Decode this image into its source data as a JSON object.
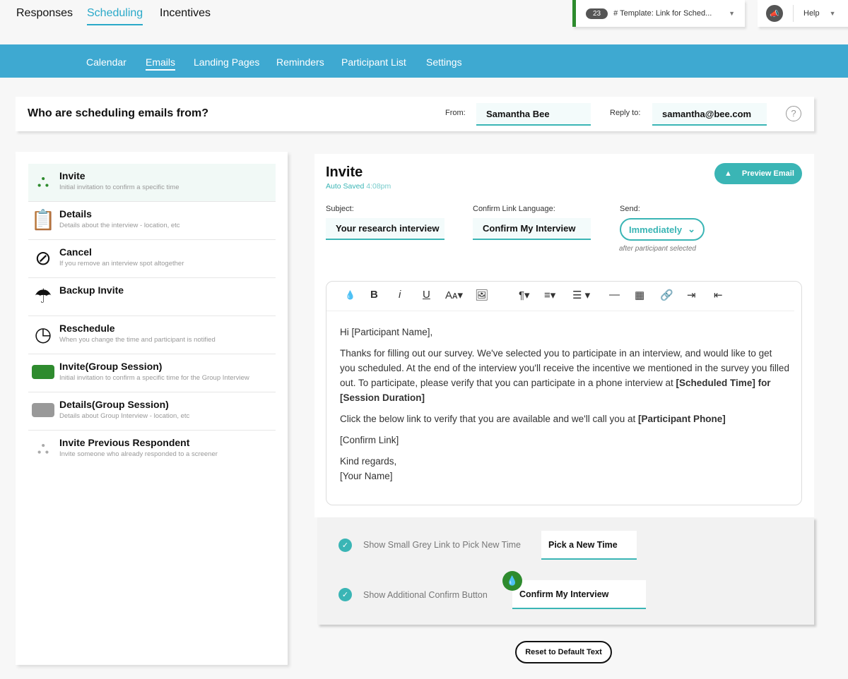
{
  "top_tabs": [
    {
      "label": "Responses"
    },
    {
      "label": "Scheduling"
    },
    {
      "label": "Incentives"
    }
  ],
  "template": {
    "count": "23",
    "name": "# Template: Link for Sched..."
  },
  "help": "Help",
  "sub_tabs": [
    {
      "label": "Calendar"
    },
    {
      "label": "Emails"
    },
    {
      "label": "Landing Pages"
    },
    {
      "label": "Reminders"
    },
    {
      "label": "Participant List"
    },
    {
      "label": "Settings"
    }
  ],
  "from_bar": {
    "title": "Who are scheduling emails from?",
    "from_label": "From:",
    "from_value": "Samantha Bee",
    "reply_label": "Reply to:",
    "reply_value": "samantha@bee.com",
    "help_icon": "?"
  },
  "email_types": [
    {
      "title": "Invite",
      "subtitle": "Initial invitation to confirm a specific time"
    },
    {
      "title": "Details",
      "subtitle": "Details about the interview - location, etc"
    },
    {
      "title": "Cancel",
      "subtitle": "If you remove an interview spot altogether"
    },
    {
      "title": "Backup Invite",
      "subtitle": ""
    },
    {
      "title": "Reschedule",
      "subtitle": "When you change the time and participant is notified"
    },
    {
      "title": "Invite(Group Session)",
      "subtitle": "Initial invitation to confirm a specific time for the Group Interview"
    },
    {
      "title": "Details(Group Session)",
      "subtitle": "Details about Group Interview - location, etc"
    },
    {
      "title": "Invite Previous Respondent",
      "subtitle": "Invite someone who already responded to a screener"
    }
  ],
  "editor": {
    "title": "Invite",
    "saved_label": "Auto Saved",
    "saved_time": "4:08pm",
    "preview_button": "Preview Email",
    "subject_label": "Subject:",
    "subject_value": "Your research interview",
    "confirm_label": "Confirm Link Language:",
    "confirm_value": "Confirm My Interview",
    "send_label": "Send:",
    "send_value": "Immediately",
    "send_note": "after participant selected",
    "body": {
      "greeting": "Hi [Participant Name],",
      "p1": "Thanks for filling out our survey. We've selected you to participate in an interview, and would like to get you scheduled. At the end of the interview you'll receive the incentive we mentioned in the survey you filled out. To participate, please verify that you can participate in a phone interview at ",
      "p1_bold": "[Scheduled Time] for [Session Duration]",
      "p2": "Click the below link to verify that you are available and we'll call you at ",
      "p2_bold": "[Participant Phone]",
      "p3": "[Confirm Link]",
      "p4a": "Kind regards,",
      "p4b": "[Your Name]"
    }
  },
  "options": {
    "grey_link_label": "Show Small Grey Link to Pick New Time",
    "grey_link_value": "Pick a New Time",
    "confirm_btn_label": "Show Additional Confirm Button",
    "confirm_btn_value": "Confirm My Interview"
  },
  "reset_button": "Reset to Default Text",
  "colors": {
    "accent": "#3ab5b5",
    "nav": "#3ea9d1",
    "green": "#2e8b2e"
  }
}
